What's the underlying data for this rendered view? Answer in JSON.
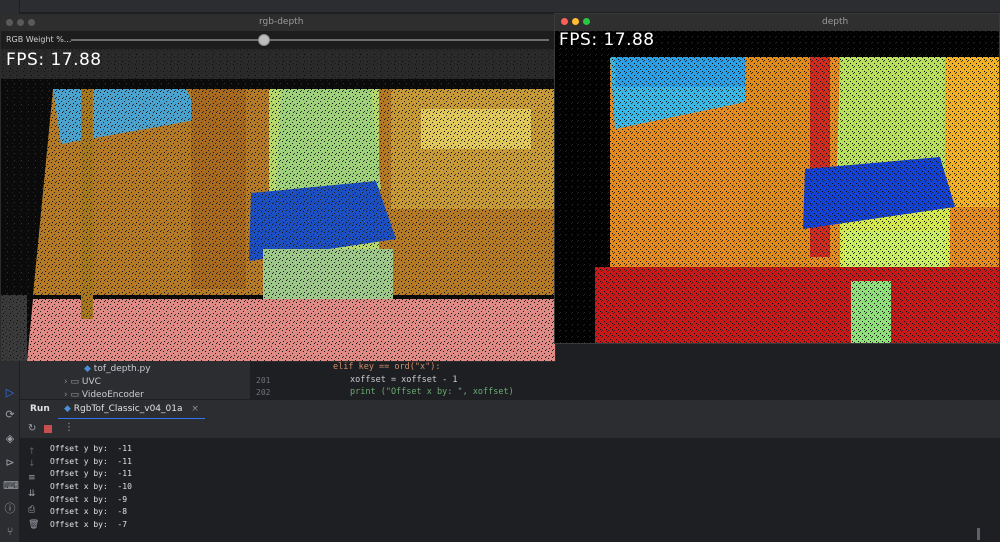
{
  "rgb_window": {
    "title": "rgb-depth",
    "slider_label": "RGB Weight %...",
    "slider_value_percent": 42,
    "fps_text": "FPS: 17.88"
  },
  "depth_window": {
    "title": "depth",
    "fps_text": "FPS: 17.88"
  },
  "project_tree": {
    "items": [
      {
        "label": "tof_depth.py",
        "icon": "python-file-icon"
      },
      {
        "label": "UVC",
        "icon": "folder-icon"
      },
      {
        "label": "VideoEncoder",
        "icon": "folder-icon"
      }
    ]
  },
  "editor": {
    "lines": [
      {
        "number": "",
        "code": "elif key == ord(\"x\"):"
      },
      {
        "number": "201",
        "code": "xoffset = xoffset - 1"
      },
      {
        "number": "202",
        "code": "print (\"Offset x by: \", xoffset)"
      }
    ]
  },
  "run_panel": {
    "label": "Run",
    "tab_label": "RgbTof_Classic_v04_01a",
    "tab_close": "×",
    "console_lines": [
      "Offset y by:  -11",
      "Offset y by:  -11",
      "Offset y by:  -11",
      "Offset x by:  -10",
      "Offset x by:  -9",
      "Offset x by:  -8",
      "Offset x by:  -7"
    ]
  },
  "toolbar_icons": [
    "run-icon",
    "plugins-icon",
    "layers-icon",
    "play-circle-icon",
    "terminal-icon",
    "problems-icon",
    "git-icon"
  ],
  "colors": {
    "ide_bg": "#1e1f22",
    "panel_bg": "#2b2d30",
    "accent": "#3574f0",
    "stop_red": "#c94f4f"
  }
}
